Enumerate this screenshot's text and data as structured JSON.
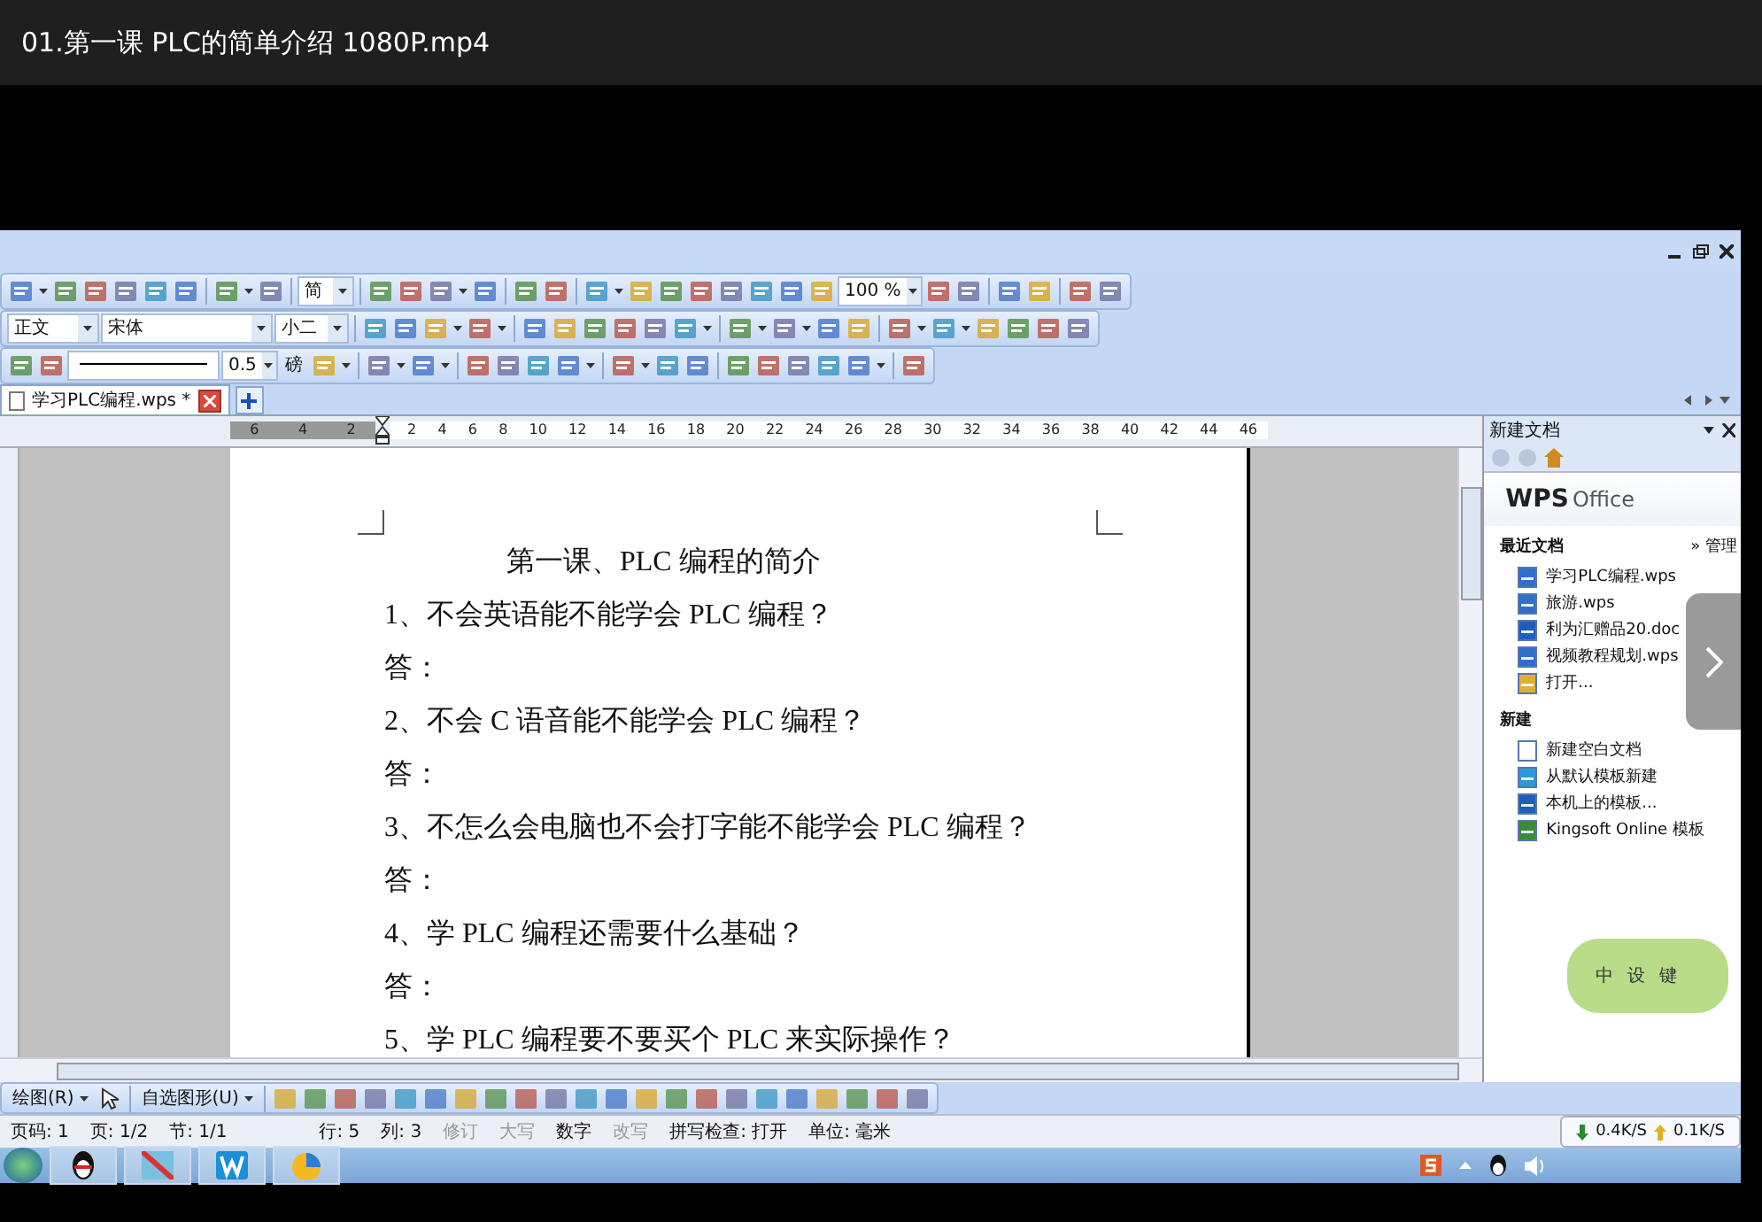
{
  "player": {
    "title": "01.第一课 PLC的简单介绍 1080P.mp4"
  },
  "toolbars": [
    {
      "fields": [
        {
          "kind": "dropdown",
          "value": "简"
        },
        {
          "kind": "dropdown",
          "value": "100 %"
        }
      ]
    },
    {
      "fields": [
        {
          "kind": "dropdown",
          "value": "正文"
        },
        {
          "kind": "dropdown",
          "value": "宋体"
        },
        {
          "kind": "dropdown",
          "value": "小二"
        }
      ]
    },
    {
      "fields": [
        {
          "kind": "line"
        },
        {
          "kind": "dropdown",
          "value": "0.5"
        },
        {
          "kind": "label",
          "value": "磅"
        }
      ]
    }
  ],
  "tabs": [
    {
      "label": "学习PLC编程.wps",
      "modified": "*",
      "selected": true
    }
  ],
  "ruler": {
    "left_numbers": [
      "6",
      "4",
      "2"
    ],
    "numbers": [
      "2",
      "4",
      "6",
      "8",
      "10",
      "12",
      "14",
      "16",
      "18",
      "20",
      "22",
      "24",
      "26",
      "28",
      "30",
      "32",
      "34",
      "36",
      "38",
      "40",
      "42",
      "44",
      "46"
    ]
  },
  "document": {
    "title": "第一课、PLC 编程的简介",
    "lines": [
      "1、不会英语能不能学会 PLC 编程？",
      "答：",
      "2、不会 C 语音能不能学会 PLC 编程？",
      "答：",
      "3、不怎么会电脑也不会打字能不能学会 PLC 编程？",
      "答：",
      "4、学 PLC 编程还需要什么基础？",
      "答：",
      "5、学 PLC 编程要不要买个 PLC 来实际操作？"
    ]
  },
  "task_pane": {
    "title": "新建文档",
    "logo": "WPS",
    "logo_sub": "Office",
    "sections": [
      {
        "title": "最近文档",
        "action": "» 管理",
        "items": [
          {
            "kind": "wps",
            "label": "学习PLC编程.wps"
          },
          {
            "kind": "wps",
            "label": "旅游.wps"
          },
          {
            "kind": "doc",
            "label": "利为汇赠品20.doc"
          },
          {
            "kind": "wps",
            "label": "视频教程规划.wps"
          },
          {
            "kind": "open",
            "label": "打开..."
          }
        ]
      },
      {
        "title": "新建",
        "items": [
          {
            "kind": "blank",
            "label": "新建空白文档"
          },
          {
            "kind": "template",
            "label": "从默认模板新建"
          },
          {
            "kind": "doc",
            "label": "本机上的模板..."
          },
          {
            "kind": "online",
            "label": "Kingsoft Online 模板"
          }
        ]
      }
    ]
  },
  "ime": [
    "中",
    "设",
    "键"
  ],
  "drawing_toolbar": [
    "绘图(R)",
    "自选图形(U)"
  ],
  "status_bar": [
    {
      "text": "页码: 1",
      "disabled": false
    },
    {
      "text": "页: 1/2",
      "disabled": false
    },
    {
      "text": "节: 1/1",
      "disabled": false
    },
    {
      "text": "行: 5",
      "disabled": false
    },
    {
      "text": "列: 3",
      "disabled": false
    },
    {
      "text": "修订",
      "disabled": true
    },
    {
      "text": "大写",
      "disabled": true
    },
    {
      "text": "数字",
      "disabled": false
    },
    {
      "text": "改写",
      "disabled": true
    },
    {
      "text": "拼写检查: 打开",
      "disabled": false
    },
    {
      "text": "单位: 毫米",
      "disabled": false
    }
  ],
  "network": {
    "down": "0.4K/S",
    "up": "0.1K/S"
  }
}
